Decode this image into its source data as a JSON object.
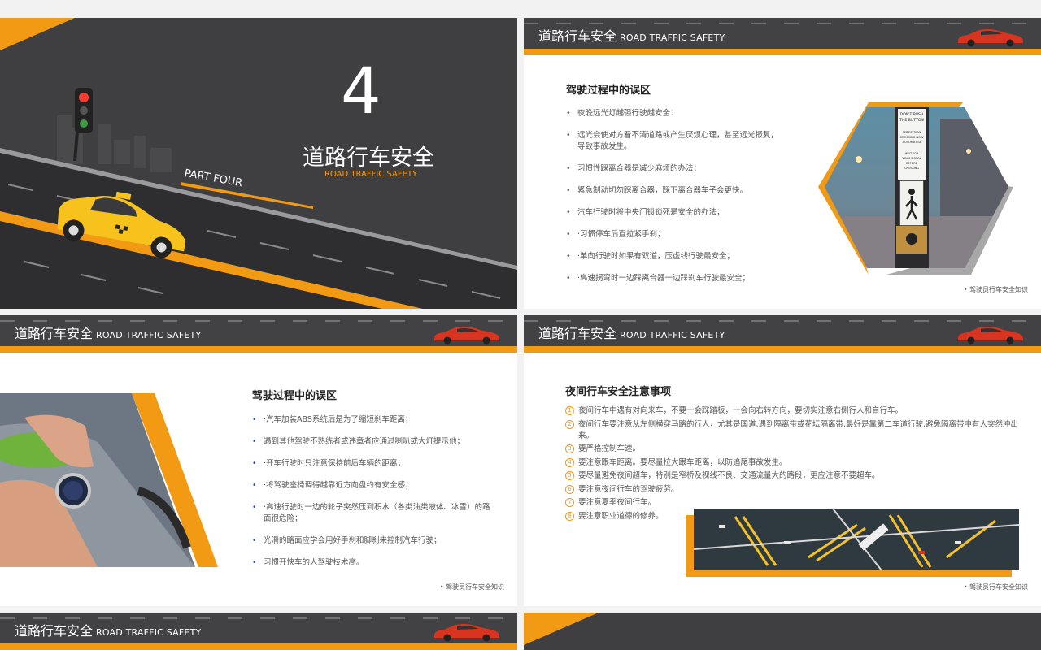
{
  "cover": {
    "number": "4",
    "title": "道路行车安全",
    "subtitle": "ROAD TRAFFIC SAFETY",
    "part": "PART FOUR"
  },
  "header": {
    "title": "道路行车安全",
    "title_en": "ROAD TRAFFIC SAFETY"
  },
  "footer_text": "驾驶员行车安全知识",
  "slide2": {
    "section_title": "驾驶过程中的误区",
    "items": [
      "夜晚远光灯越强行驶越安全：",
      "远光会使对方看不清道路或产生厌烦心理，甚至远光报复，导致事故发生。",
      "习惯性踩离合器是减少麻烦的办法：",
      "紧急制动切勿踩离合器，踩下离合器车子会更快。",
      "汽车行驶时将中央门锁锁死是安全的办法；",
      "·习惯停车后直拉紧手刹；",
      "·单向行驶时如果有双道，压虚线行驶最安全；",
      "·高速拐弯时一边踩离合器一边踩刹车行驶最安全；"
    ],
    "sign_text": [
      "DON'T PUSH",
      "THE BUTTON",
      "PEDESTRIAN",
      "CROSSING NOW",
      "AUTOMATED",
      "WAIT FOR",
      "WALK SIGNAL",
      "BEFORE",
      "CROSSING"
    ]
  },
  "slide3": {
    "section_title": "驾驶过程中的误区",
    "items": [
      "·汽车加装ABS系统后是为了缩短刹车距离；",
      "遇到其他驾驶不熟练者或违章者应通过喇叭或大灯提示他；",
      "·开车行驶时只注意保持前后车辆的距离；",
      "·将驾驶座椅调得越靠近方向盘约有安全感；",
      "·高速行驶时一边的轮子突然压到积水（各类油类液体、冰雪）的路面很危险；",
      "光滑的路面应学会用好手刹和脚刹来控制汽车行驶；",
      "习惯开快车的人驾驶技术高。"
    ]
  },
  "slide4": {
    "section_title": "夜间行车安全注意事项",
    "items": [
      {
        "num": "1",
        "text": "夜间行车中遇有对向来车，不要一会踩踏板，一会向右转方向，要切实注意右侧行人和自行车。"
      },
      {
        "num": "2",
        "text": "夜间行车要注意从左侧横穿马路的行人，尤其是国道,遇到隔离带或花坛隔离带,最好是靠第二车道行驶,避免隔离带中有人突然冲出来。"
      },
      {
        "num": "3",
        "text": "要严格控制车速。"
      },
      {
        "num": "4",
        "text": "要注意跟车距离。要尽量拉大跟车距离，以防追尾事故发生。"
      },
      {
        "num": "5",
        "text": "要尽量避免夜间超车，特别是窄桥及视线不良、交通流量大的路段，更应注意不要超车。"
      },
      {
        "num": "6",
        "text": "要注意夜间行车的驾驶疲劳。"
      },
      {
        "num": "7",
        "text": "要注意夏季夜间行车。"
      },
      {
        "num": "8",
        "text": "要注意职业道德的修养。"
      }
    ]
  },
  "colors": {
    "accent": "#f29a14",
    "dark": "#3f3f41",
    "header": "#424244"
  }
}
